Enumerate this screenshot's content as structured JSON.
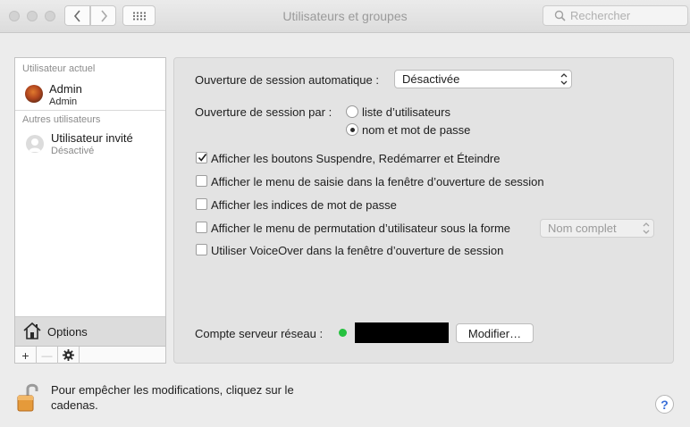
{
  "window": {
    "title": "Utilisateurs et groupes"
  },
  "toolbar": {
    "search_placeholder": "Rechercher"
  },
  "sidebar": {
    "current_header": "Utilisateur actuel",
    "current_user": {
      "name": "Admin",
      "role": "Admin"
    },
    "others_header": "Autres utilisateurs",
    "guest_user": {
      "name": "Utilisateur invité",
      "status": "Désactivé"
    },
    "options_label": "Options",
    "add_symbol": "+",
    "remove_symbol": "—"
  },
  "login": {
    "auto_login_label": "Ouverture de session automatique :",
    "auto_login_value": "Désactivée",
    "display_label": "Ouverture de session par :",
    "radio_options": [
      {
        "label": "liste d’utilisateurs",
        "selected": false
      },
      {
        "label": "nom et mot de passe",
        "selected": true
      }
    ],
    "checkboxes": [
      {
        "label": "Afficher les boutons Suspendre, Redémarrer et Éteindre",
        "checked": true
      },
      {
        "label": "Afficher le menu de saisie dans la fenêtre d’ouverture de session",
        "checked": false
      },
      {
        "label": "Afficher les indices de mot de passe",
        "checked": false
      },
      {
        "label": "Afficher le menu de permutation d’utilisateur sous la forme",
        "checked": false
      },
      {
        "label": "Utiliser VoiceOver dans la fenêtre d’ouverture de session",
        "checked": false
      }
    ],
    "fast_switch_value": "Nom complet",
    "network_label": "Compte serveur réseau :",
    "network_status_color": "#26c13f",
    "modify_button": "Modifier…"
  },
  "footer": {
    "lock_text": "Pour empêcher les modifications, cliquez sur le cadenas.",
    "help_label": "?"
  },
  "colors": {
    "accent_check": "#1d1d1d",
    "help_blue": "#3a6fd8"
  },
  "icons": [
    "back-icon",
    "forward-icon",
    "grid-icon",
    "search-icon",
    "house-icon",
    "gear-icon",
    "lock-icon",
    "guest-avatar-icon"
  ]
}
